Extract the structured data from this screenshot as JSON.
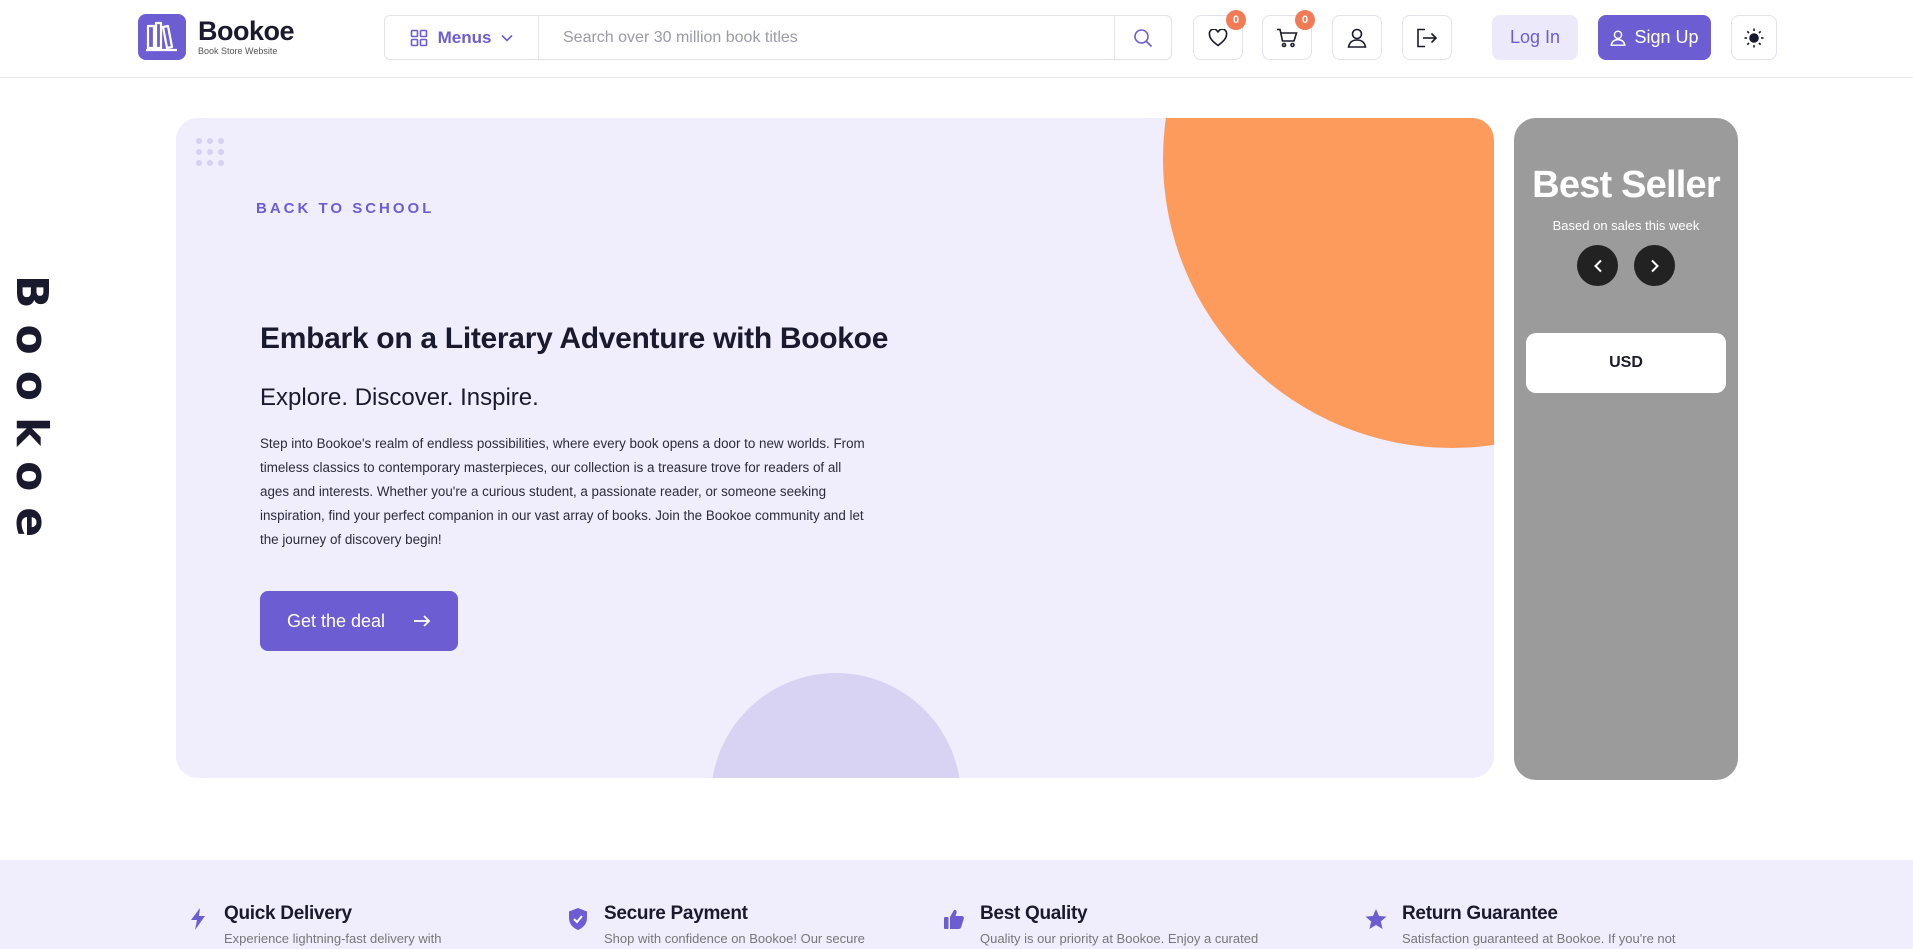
{
  "header": {
    "brand": {
      "name": "Bookoe",
      "tagline": "Book Store Website",
      "icon": "bookshelf-logo-icon"
    },
    "menus_label": "Menus",
    "search_placeholder": "Search over 30 million book titles",
    "wishlist_count": "0",
    "cart_count": "0",
    "login_label": "Log In",
    "signup_label": "Sign Up"
  },
  "side_brand": "Bookoe",
  "hero": {
    "kicker": "BACK TO SCHOOL",
    "title": "Embark on a Literary Adventure with Bookoe",
    "subtitle": "Explore. Discover. Inspire.",
    "body": "Step into Bookoe's realm of endless possibilities, where every book opens a door to new worlds. From timeless classics to contemporary masterpieces, our collection is a treasure trove for readers of all ages and interests. Whether you're a curious student, a passionate reader, or someone seeking inspiration, find your perfect companion in our vast array of books. Join the Bookoe community and let the journey of discovery begin!",
    "cta": "Get the deal"
  },
  "best_seller": {
    "title": "Best Seller",
    "subtitle": "Based on sales this week",
    "currency": "USD"
  },
  "features": [
    {
      "title": "Quick Delivery",
      "desc": "Experience lightning-fast delivery with",
      "icon": "lightning-icon"
    },
    {
      "title": "Secure Payment",
      "desc": "Shop with confidence on Bookoe! Our secure",
      "icon": "shield-check-icon"
    },
    {
      "title": "Best Quality",
      "desc": "Quality is our priority at Bookoe. Enjoy a curated",
      "icon": "thumbs-up-icon"
    },
    {
      "title": "Return Guarantee",
      "desc": "Satisfaction guaranteed at Bookoe. If you're not",
      "icon": "star-icon"
    }
  ],
  "colors": {
    "accent": "#6c5dd3",
    "hero_bg": "#f0edfc",
    "orange": "#fd9b5d",
    "badge": "#f27a54",
    "seller_bg": "#9b9b9b"
  }
}
